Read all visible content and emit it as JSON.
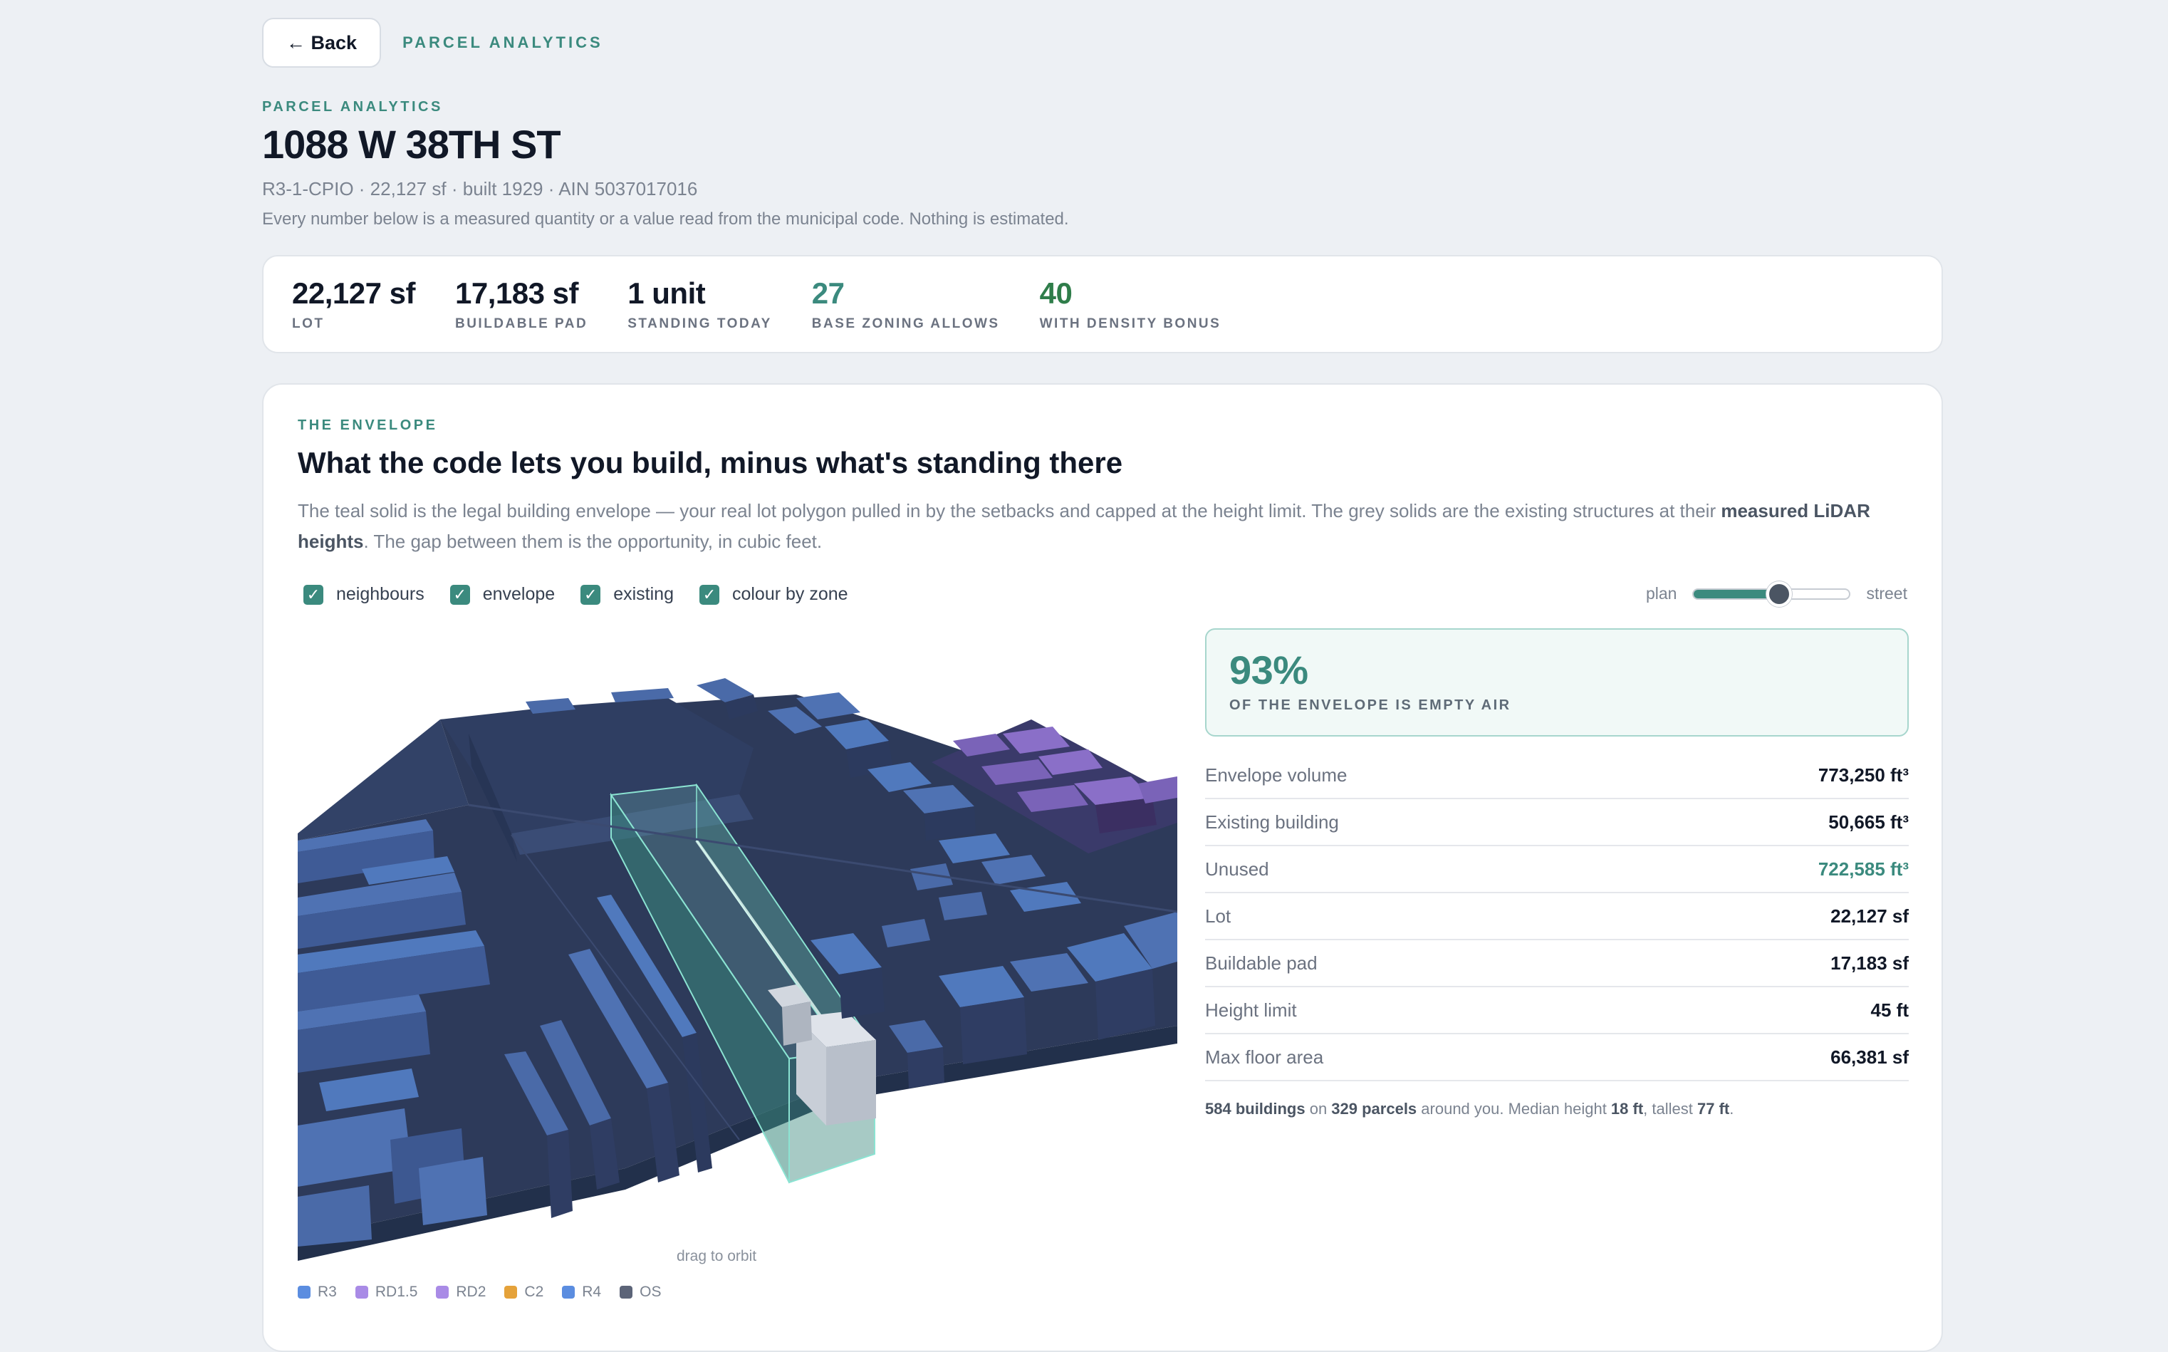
{
  "nav": {
    "back_label": "← Back",
    "crumb": "PARCEL ANALYTICS"
  },
  "header": {
    "eyebrow": "PARCEL ANALYTICS",
    "title": "1088 W 38TH ST",
    "subline": "R3-1-CPIO · 22,127 sf · built 1929 · AIN 5037017016",
    "note": "Every number below is a measured quantity or a value read from the municipal code. Nothing is estimated."
  },
  "stats": [
    {
      "value": "22,127 sf",
      "label": "LOT"
    },
    {
      "value": "17,183 sf",
      "label": "BUILDABLE PAD"
    },
    {
      "value": "1 unit",
      "label": "STANDING TODAY"
    },
    {
      "value": "27",
      "label": "BASE ZONING ALLOWS"
    },
    {
      "value": "40",
      "label": "WITH DENSITY BONUS"
    }
  ],
  "envelope": {
    "eyebrow": "THE ENVELOPE",
    "title": "What the code lets you build, minus what's standing there",
    "desc_before": "The teal solid is the legal building envelope — your real lot polygon pulled in by the setbacks and capped at the height limit. The grey solids are the existing structures at their ",
    "desc_bold": "measured LiDAR heights",
    "desc_after": ". The gap between them is the opportunity, in cubic feet.",
    "toggles": [
      "neighbours",
      "envelope",
      "existing",
      "colour by zone"
    ],
    "slider": {
      "left": "plan",
      "right": "street",
      "value": 0.55
    },
    "orbit_hint": "drag to orbit",
    "legend": [
      {
        "label": "R3",
        "color": "#5b8de0"
      },
      {
        "label": "RD1.5",
        "color": "#a98be6"
      },
      {
        "label": "RD2",
        "color": "#a98be6"
      },
      {
        "label": "C2",
        "color": "#e5a23a"
      },
      {
        "label": "R4",
        "color": "#5b8de0"
      },
      {
        "label": "OS",
        "color": "#5c6478"
      }
    ]
  },
  "panel": {
    "empty_value": "93%",
    "empty_label": "OF THE ENVELOPE IS EMPTY AIR",
    "rows": [
      {
        "label": "Envelope volume",
        "value": "773,250 ft³"
      },
      {
        "label": "Existing building",
        "value": "50,665 ft³"
      },
      {
        "label": "Unused",
        "value": "722,585 ft³"
      },
      {
        "label": "Lot",
        "value": "22,127 sf"
      },
      {
        "label": "Buildable pad",
        "value": "17,183 sf"
      },
      {
        "label": "Height limit",
        "value": "45 ft"
      },
      {
        "label": "Max floor area",
        "value": "66,381 sf"
      }
    ],
    "summary": {
      "buildings": "584 buildings",
      "t1": " on ",
      "parcels": "329 parcels",
      "t2": " around you. Median height ",
      "median": "18 ft",
      "t3": ", tallest ",
      "tallest": "77 ft",
      "t4": "."
    }
  }
}
